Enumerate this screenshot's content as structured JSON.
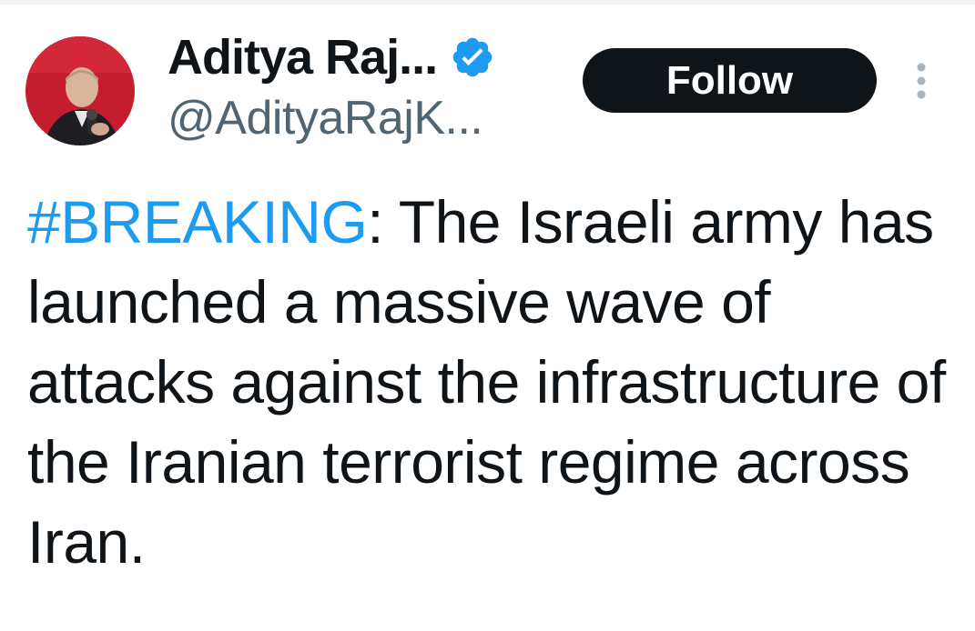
{
  "author": {
    "display_name": "Aditya Raj...",
    "handle": "@AdityaRajK...",
    "verified": true,
    "avatar_icon": "avatar-photo"
  },
  "actions": {
    "follow_label": "Follow",
    "more_icon": "more-vertical-icon"
  },
  "tweet": {
    "hashtag": "#BREAKING",
    "body": ": The Israeli army has launched a massive wave of attacks against the infrastructure of the Iranian terrorist regime across Iran."
  },
  "colors": {
    "hashtag": "#1d9bf0",
    "verified_badge": "#1d9bf0",
    "follow_bg": "#0f1419",
    "handle": "#536471"
  }
}
